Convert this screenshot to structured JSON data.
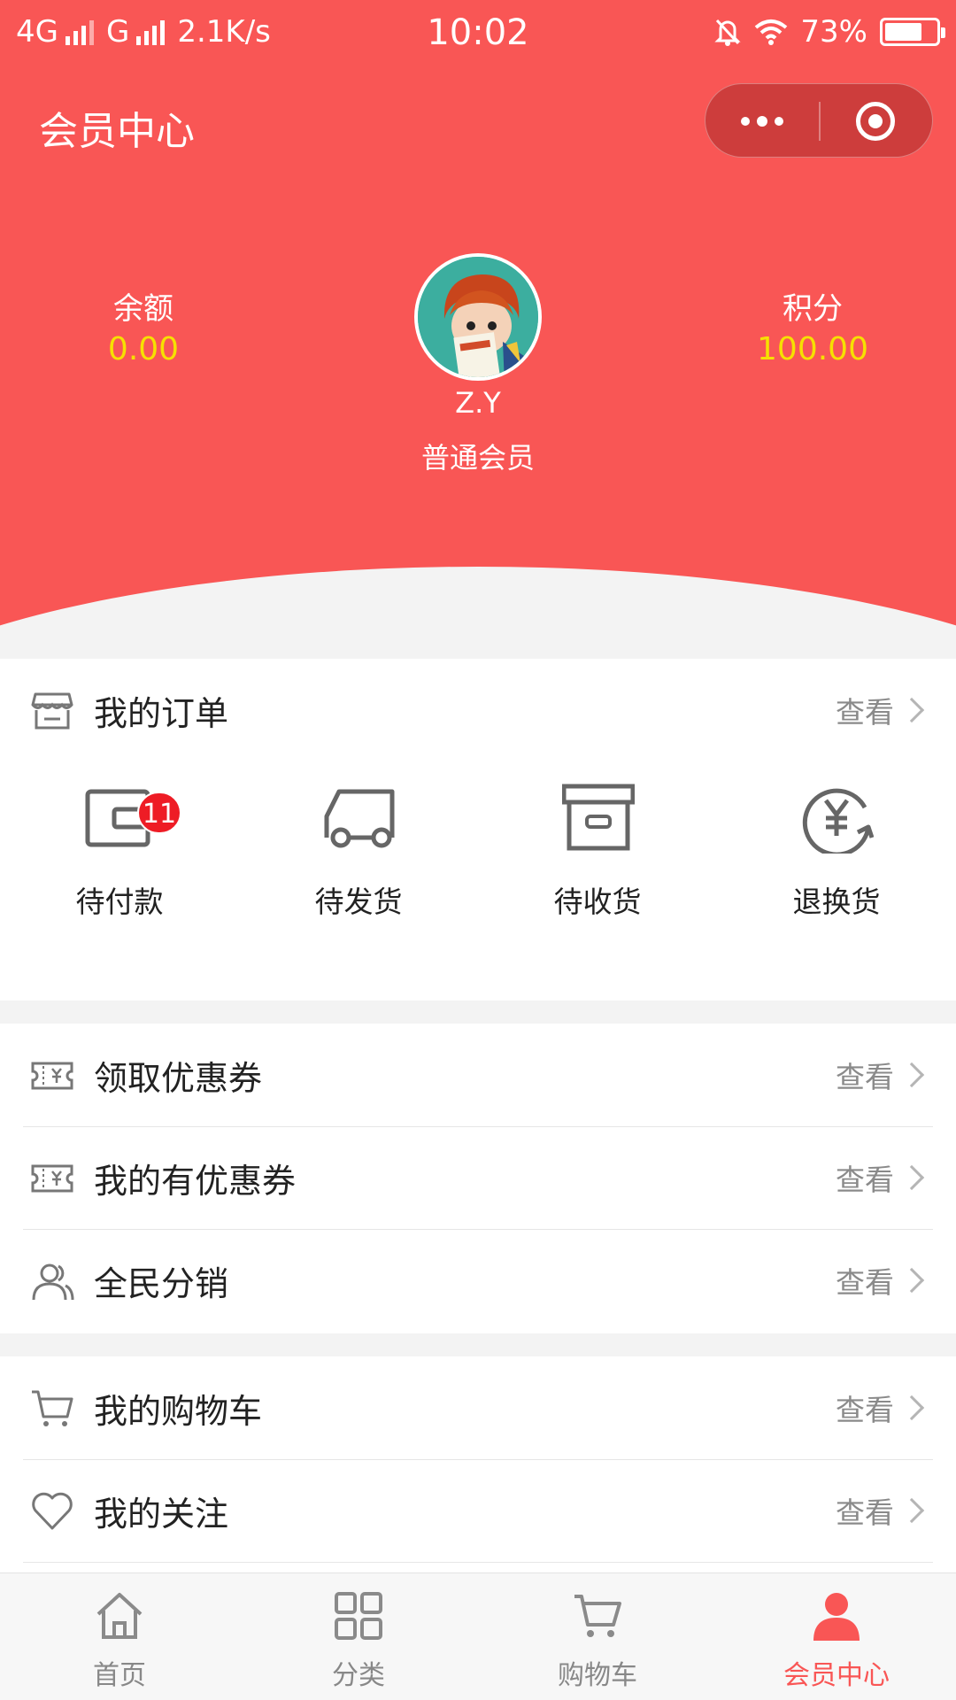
{
  "status_bar": {
    "network1": "4G",
    "network2": "G",
    "speed": "2.1K/s",
    "time": "10:02",
    "battery": "73%",
    "battery_level": 0.73
  },
  "header": {
    "title": "会员中心",
    "balance_label": "余额",
    "balance_value": "0.00",
    "points_label": "积分",
    "points_value": "100.00",
    "username": "Z.Y",
    "member_level": "普通会员"
  },
  "orders": {
    "title": "我的订单",
    "view": "查看",
    "items": [
      {
        "label": "待付款",
        "badge": "11"
      },
      {
        "label": "待发货"
      },
      {
        "label": "待收货"
      },
      {
        "label": "退换货"
      }
    ]
  },
  "menu1": [
    {
      "label": "领取优惠券",
      "view": "查看"
    },
    {
      "label": "我的有优惠券",
      "view": "查看"
    },
    {
      "label": "全民分销",
      "view": "查看"
    }
  ],
  "menu2": [
    {
      "label": "我的购物车",
      "view": "查看"
    },
    {
      "label": "我的关注",
      "view": "查看"
    }
  ],
  "tabbar": [
    {
      "label": "首页",
      "icon": "home-icon"
    },
    {
      "label": "分类",
      "icon": "grid-icon"
    },
    {
      "label": "购物车",
      "icon": "cart-icon"
    },
    {
      "label": "会员中心",
      "icon": "person-icon",
      "active": true
    }
  ],
  "colors": {
    "brand": "#f95655",
    "value_yellow": "#f6e000",
    "badge": "#ee1c25"
  }
}
